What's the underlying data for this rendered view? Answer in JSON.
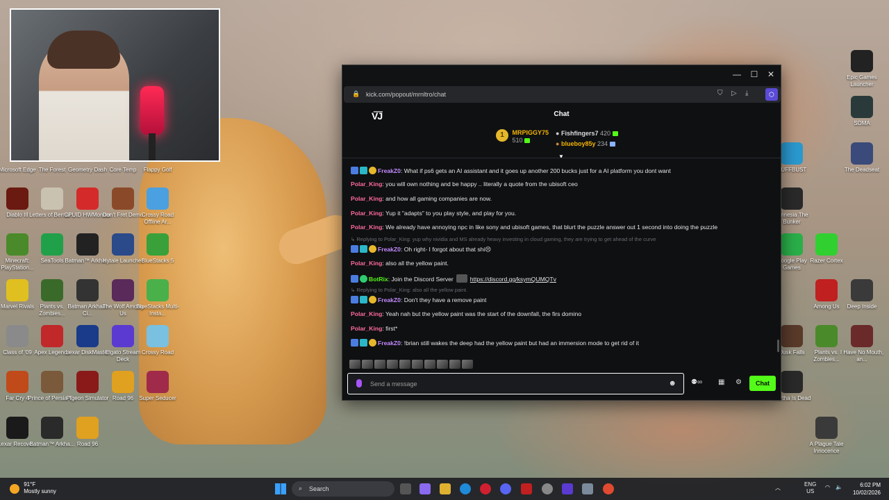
{
  "desktop": {
    "left_icons": [
      {
        "label": "Microsoft Edge",
        "color": "#1f8ad8"
      },
      {
        "label": "The Forest",
        "color": "#3a5a2a"
      },
      {
        "label": "Geometry Dash",
        "color": "#e0a020"
      },
      {
        "label": "Core Temp",
        "color": "#2f5f9f"
      },
      {
        "label": "Flappy Golf",
        "color": "#7aa040"
      },
      {
        "label": "Diablo III",
        "color": "#6a1a10"
      },
      {
        "label": "Letters of Bernar...",
        "color": "#c9c2b0"
      },
      {
        "label": "CPUID HWMonitor",
        "color": "#d42a2a"
      },
      {
        "label": "Don't Fret Demo",
        "color": "#8a4a2a"
      },
      {
        "label": "Crossy Road Offline Ar...",
        "color": "#4aa0e0"
      },
      {
        "label": "Minecraft: PlayStation...",
        "color": "#4a8a2a"
      },
      {
        "label": "SeaTools",
        "color": "#21a04a"
      },
      {
        "label": "Batman™ Arkha...",
        "color": "#222222"
      },
      {
        "label": "Hytale Launcher",
        "color": "#2a4a8a"
      },
      {
        "label": "BlueStacks 5",
        "color": "#3aa03a"
      },
      {
        "label": "Marvel Rivals",
        "color": "#e0c020"
      },
      {
        "label": "Plants vs. Zombies...",
        "color": "#3a6a2a"
      },
      {
        "label": "Batman Arkham Ci...",
        "color": "#333333"
      },
      {
        "label": "The Wolf Among Us",
        "color": "#5a2a5a"
      },
      {
        "label": "BlueStacks Multi-Insta...",
        "color": "#4ab04a"
      },
      {
        "label": "Class of '09",
        "color": "#8a8a8a"
      },
      {
        "label": "Apex Legends",
        "color": "#c0282a"
      },
      {
        "label": "Lexar DiskMaster",
        "color": "#1a3a8a"
      },
      {
        "label": "Elgato Stream Deck",
        "color": "#5a3ad0"
      },
      {
        "label": "Crossy Road",
        "color": "#7ac0e0"
      },
      {
        "label": "Far Cry 4",
        "color": "#c04a1a"
      },
      {
        "label": "Prince of Persia T...",
        "color": "#7a5a3a"
      },
      {
        "label": "Pigeon Simulator",
        "color": "#8a1a1a"
      },
      {
        "label": "Road 96",
        "color": "#e0a020"
      },
      {
        "label": "Super Seducer",
        "color": "#a02a4a"
      },
      {
        "label": "Lexar Recove...",
        "color": "#1a1a1a"
      },
      {
        "label": "Batman™ Arkha...",
        "color": "#2a2a2a"
      },
      {
        "label": "Road 96",
        "color": "#e0a020"
      }
    ],
    "right_icons": [
      {
        "label": "Epic Games Launcher",
        "color": "#222222"
      },
      {
        "label": "SOMA",
        "color": "#2a3a3a"
      },
      {
        "label": "CUFFBUST",
        "color": "#2a9ad0"
      },
      {
        "label": "The Deadseat",
        "color": "#3a4a7a"
      },
      {
        "label": "Amnesia The Bunker",
        "color": "#2a2a2a"
      },
      {
        "label": "Google Play Games",
        "color": "#2ab04a"
      },
      {
        "label": "Razer Cortex",
        "color": "#30d030"
      },
      {
        "label": "Among Us",
        "color": "#c02020"
      },
      {
        "label": "Deep Inside",
        "color": "#3a3a3a"
      },
      {
        "label": "Dusk Falls",
        "color": "#5a3a2a"
      },
      {
        "label": "Plants vs. Zombies...",
        "color": "#4a8a2a"
      },
      {
        "label": "I Have No Mouth, an...",
        "color": "#6a2a2a"
      },
      {
        "label": "Martha Is Dead",
        "color": "#2a2a2a"
      },
      {
        "label": "A Plague Tale Innocence",
        "color": "#3a3a3a"
      }
    ]
  },
  "browser": {
    "url": "kick.com/popout/mrnltro/chat",
    "window_controls": {
      "minimize": "—",
      "maximize": "☐",
      "close": "✕"
    },
    "logo": "V͞J",
    "title": "Chat",
    "leaderboard": {
      "first": {
        "rank": "1",
        "name": "MRPIGGY75",
        "points": "510"
      },
      "second": {
        "name": "Fishfingers7",
        "points": "420"
      },
      "third": {
        "name": "blueboy85y",
        "points": "234"
      }
    }
  },
  "messages": [
    {
      "type": "msg",
      "user": "FreakZ0",
      "style": "freak",
      "badges": [
        "blue",
        "teal",
        "gold"
      ],
      "text": ": What if ps6 gets an AI assistant and it goes up another 200 bucks just for a AI platform you dont want"
    },
    {
      "type": "msg",
      "user": "Polar_King",
      "style": "green",
      "badges": [],
      "text": ": you will own nothing and be happy .. literally a quote from the ubisoft ceo"
    },
    {
      "type": "msg",
      "user": "Polar_King",
      "style": "green",
      "badges": [],
      "text": ": and how all gaming companies are now."
    },
    {
      "type": "msg",
      "user": "Polar_King",
      "style": "green",
      "badges": [],
      "text": ": Yup it \"adapts\" to you play style, and play for you."
    },
    {
      "type": "msg",
      "user": "Polar_King",
      "style": "green",
      "badges": [],
      "text": ": We already have annoying npc in like sony and ubisoft games, that blurt the puzzle answer out 1 second into doing the puzzle"
    },
    {
      "type": "reply",
      "text": "↳ Replying to Polar_King: yup why nividia and MS already heavy investing in cloud gaming, they are trying to get ahead of the curve"
    },
    {
      "type": "msg",
      "user": "FreakZ0",
      "style": "freak",
      "badges": [
        "blue",
        "teal",
        "gold"
      ],
      "text": ": Oh right- I forgot about that shi😣"
    },
    {
      "type": "msg",
      "user": "Polar_King",
      "style": "green",
      "badges": [],
      "text": ": also all the yellow paint."
    },
    {
      "type": "bot",
      "user": "BotRix",
      "style": "bot",
      "badges": [
        "blue",
        "green"
      ],
      "text": ": Join the Discord Server",
      "link": "https://discord.gg/ksymQUMQTv"
    },
    {
      "type": "reply",
      "text": "↳ Replying to Polar_King: also all the yellow paint."
    },
    {
      "type": "msg",
      "user": "FreakZ0",
      "style": "freak",
      "badges": [
        "blue",
        "teal",
        "gold"
      ],
      "text": ": Don't they have a remove paint"
    },
    {
      "type": "msg",
      "user": "Polar_King",
      "style": "green",
      "badges": [],
      "text": ": Yeah nah but the yellow paint was the start of the downfall, the firs domino"
    },
    {
      "type": "msg",
      "user": "Polar_King",
      "style": "green",
      "badges": [],
      "text": ": first*"
    },
    {
      "type": "msg",
      "user": "FreakZ0",
      "style": "freak",
      "badges": [
        "blue",
        "teal",
        "gold"
      ],
      "text": ": !brian still wakes the deep had the yellow paint but had an immersion mode to get rid of it"
    }
  ],
  "composer": {
    "placeholder": "Send a message",
    "send_label": "Chat"
  },
  "taskbar": {
    "weather_temp": "91°F",
    "weather_desc": "Mostly sunny",
    "search_label": "Search",
    "lang": "ENG",
    "region": "US",
    "time": "6:02 PM",
    "date": "10/02/2026"
  }
}
